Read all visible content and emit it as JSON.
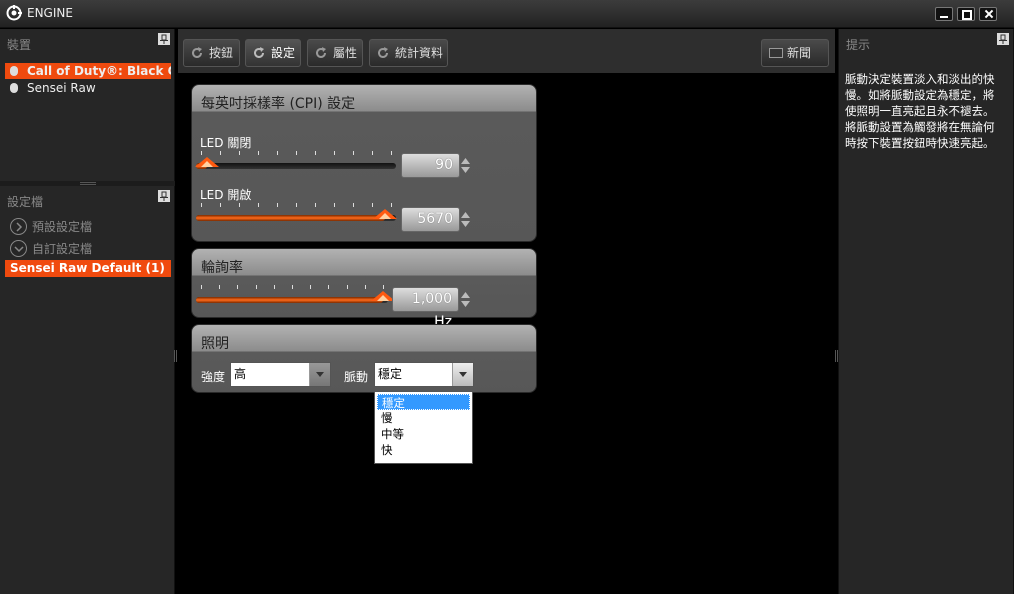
{
  "app": {
    "title": "ENGINE"
  },
  "devices": {
    "header": "裝置",
    "items": [
      {
        "label": "Call of Duty®: Black O..."
      },
      {
        "label": "Sensei Raw"
      }
    ]
  },
  "profiles": {
    "header": "設定檔",
    "groups": [
      {
        "label": "預設設定檔"
      },
      {
        "label": "自訂設定檔"
      }
    ],
    "selected": "Sensei Raw Default (1)"
  },
  "toolbar": {
    "buttons_label": "按鈕",
    "settings_label": "設定",
    "properties_label": "屬性",
    "stats_label": "統計資料",
    "news_label": "新聞"
  },
  "cpi": {
    "title": "每英吋採樣率 (CPI) 設定",
    "led_off": {
      "label": "LED 關閉",
      "value": "90",
      "fraction": 0.03
    },
    "led_on": {
      "label": "LED 開啟",
      "value": "5670",
      "fraction": 0.97
    }
  },
  "polling": {
    "title": "輪詢率",
    "value": "1,000 Hz",
    "fraction": 1.0
  },
  "lighting": {
    "title": "照明",
    "intensity_label": "強度",
    "intensity_value": "高",
    "pulse_label": "脈動",
    "pulse_value": "穩定",
    "pulse_options": [
      {
        "label": "穩定"
      },
      {
        "label": "慢"
      },
      {
        "label": "中等"
      },
      {
        "label": "快"
      }
    ]
  },
  "hint": {
    "header": "提示",
    "lines": [
      "脈動決定裝置淡入和淡出的快",
      "慢。如將脈動設定為穩定，將",
      "使照明一直亮起且永不褪去。",
      "將脈動設置為觸發將在無論何",
      "時按下裝置按鈕時快速亮起。"
    ]
  },
  "colors": {
    "accent": "#f04a0e",
    "selection": "#3399ff"
  }
}
